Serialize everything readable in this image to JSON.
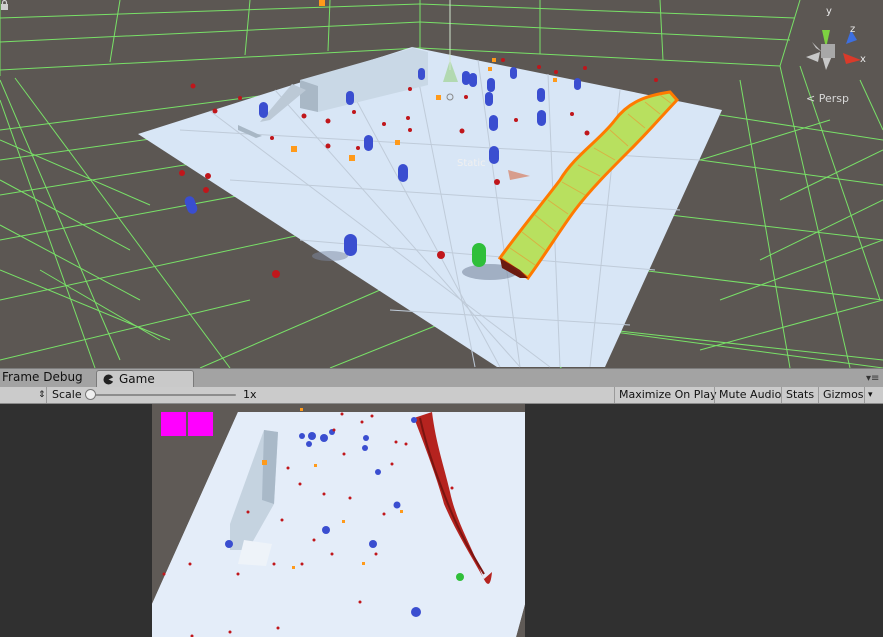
{
  "scene_view": {
    "camera_mode": "Persp",
    "static_label": "Static",
    "gizmo_axes": [
      "y",
      "z",
      "x"
    ],
    "grid_color": "#7cf06a",
    "ground_color": "#d8e6f6",
    "background_color": "#5c5753",
    "ribbon_outline_color": "#ff7a00"
  },
  "panel_tabs": [
    {
      "label": "Frame Debug",
      "active": false
    },
    {
      "label": "Game",
      "active": true
    }
  ],
  "toolbar": {
    "scale_label": "Scale",
    "scale_value": "1x",
    "scale_fraction": 0.0,
    "maximize_on_play": "Maximize On Play",
    "mute_audio": "Mute Audio",
    "stats": "Stats",
    "gizmos": "Gizmos"
  },
  "game_view": {
    "ribbon_color": "#b5231f",
    "marker_color": "#ff00ff"
  }
}
